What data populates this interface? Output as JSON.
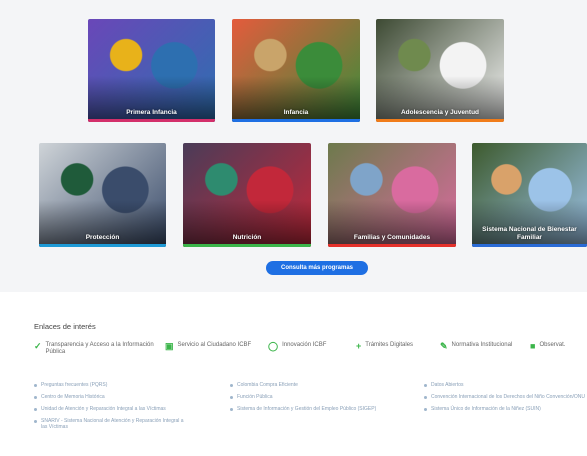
{
  "programs": [
    {
      "id": "t1",
      "label": "Primera Infancia",
      "bar": "#d32f6b",
      "photo": [
        "#6a47b8",
        "#2d6fb0",
        "#e8b21a"
      ]
    },
    {
      "id": "t2",
      "label": "Infancia",
      "bar": "#1e6fe3",
      "photo": [
        "#e45b3c",
        "#3b8c3a",
        "#c9a46a"
      ]
    },
    {
      "id": "t3",
      "label": "Adolescencia y Juventud",
      "bar": "#f07c1a",
      "photo": [
        "#3d4a33",
        "#f3f3f3",
        "#6f8a4e"
      ]
    },
    {
      "id": "t4",
      "label": "Protección",
      "bar": "#1e9ad6",
      "photo": [
        "#cfd4d8",
        "#3a4c6b",
        "#1f5b3a"
      ]
    },
    {
      "id": "t5",
      "label": "Nutrición",
      "bar": "#3bb54a",
      "photo": [
        "#4a3c58",
        "#c2283a",
        "#2e8b6f"
      ]
    },
    {
      "id": "t6",
      "label": "Familias y Comunidades",
      "bar": "#e5312b",
      "photo": [
        "#6d7a4c",
        "#d96b9f",
        "#7fa4c9"
      ]
    },
    {
      "id": "t7",
      "label": "Sistema Nacional de Bienestar Familiar",
      "bar": "#2a6bd6",
      "photo": [
        "#3d5a2d",
        "#9cc3e8",
        "#d9a26a"
      ]
    }
  ],
  "more_button": "Consulta más programas",
  "links": {
    "title": "Enlaces de interés",
    "highlights": [
      {
        "icon": "✓",
        "label": "Transparencia y Acceso a la Información Pública",
        "color": "#3bb54a"
      },
      {
        "icon": "▣",
        "label": "Servicio al Ciudadano ICBF",
        "color": "#3bb54a"
      },
      {
        "icon": "◯",
        "label": "Innovación ICBF",
        "color": "#3bb54a"
      },
      {
        "icon": "+",
        "label": "Trámites Digitales",
        "color": "#3bb54a"
      },
      {
        "icon": "✎",
        "label": "Normativa Institucional",
        "color": "#3bb54a"
      },
      {
        "icon": "■",
        "label": "Observat.",
        "color": "#3bb54a"
      }
    ],
    "columns": [
      [
        "Preguntas frecuentes (PQRS)",
        "Centro de Memoria Histórica",
        "Unidad de Atención y Reparación Integral a las Víctimas",
        "SNARIV - Sistema Nacional de Atención y Reparación Integral a las Víctimas"
      ],
      [
        "Colombia Compra Eficiente",
        "Función Pública",
        "Sistema de Información y Gestión del Empleo Público (SIGEP)"
      ],
      [
        "Datos Abiertos",
        "Convención Internacional de los Derechos del Niño Convención/ONU",
        "Sistema Único de Información de la Niñez (SUIN)"
      ]
    ]
  }
}
